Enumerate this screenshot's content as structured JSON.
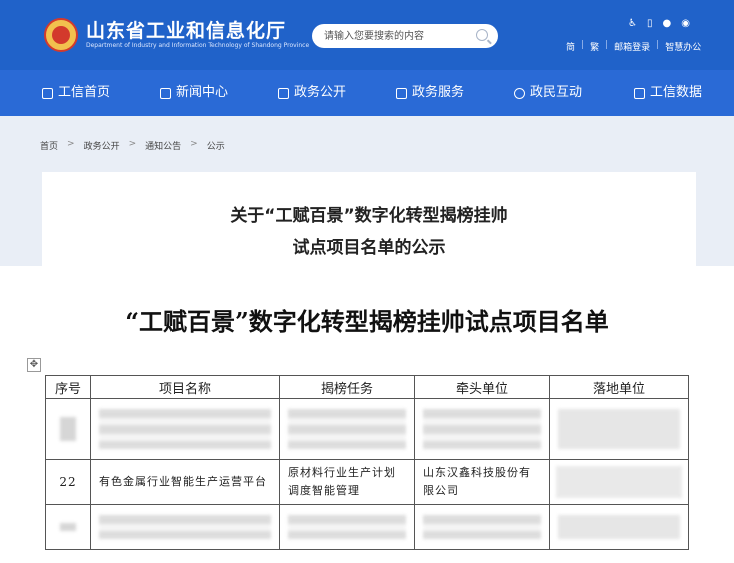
{
  "header": {
    "title": "山东省工业和信息化厅",
    "subtitle": "Department of Industry and Information Technology of Shandong Province",
    "search_placeholder": "请输入您要搜索的内容",
    "lang_simplified": "简",
    "lang_traditional": "繁",
    "mail_login": "邮箱登录",
    "smart_office": "智慧办公",
    "tool_icons": [
      "accessibility-icon",
      "mobile-icon",
      "wechat-icon",
      "weibo-icon"
    ]
  },
  "nav": {
    "items": [
      {
        "label": "工信首页",
        "icon": "home-icon"
      },
      {
        "label": "新闻中心",
        "icon": "news-icon"
      },
      {
        "label": "政务公开",
        "icon": "monitor-icon"
      },
      {
        "label": "政务服务",
        "icon": "service-icon"
      },
      {
        "label": "政民互动",
        "icon": "interaction-icon"
      },
      {
        "label": "工信数据",
        "icon": "database-icon"
      }
    ]
  },
  "breadcrumb": [
    "首页",
    "政务公开",
    "通知公告",
    "公示"
  ],
  "article": {
    "title_line1": "关于“工赋百景”数字化转型揭榜挂帅",
    "title_line2": "试点项目名单的公示"
  },
  "document": {
    "title": "“工赋百景”数字化转型揭榜挂帅试点项目名单",
    "table": {
      "headers": [
        "序号",
        "项目名称",
        "揭榜任务",
        "牵头单位",
        "落地单位"
      ],
      "row": {
        "index": "22",
        "project": "有色金属行业智能生产运营平台",
        "task": "原材料行业生产计划调度智能管理",
        "lead": "山东汉鑫科技股份有限公司",
        "site": ""
      }
    }
  },
  "colors": {
    "header_blue": "#2062c9",
    "nav_blue": "#2a6ad6",
    "page_bg": "#e9eef6"
  }
}
